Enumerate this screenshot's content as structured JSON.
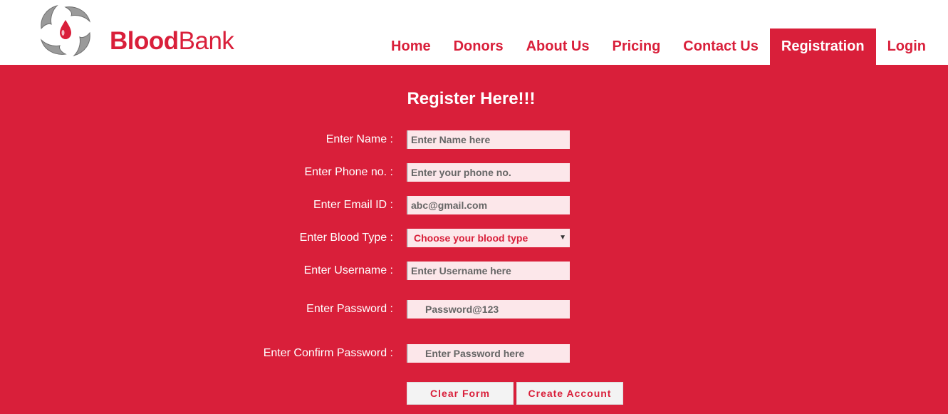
{
  "brand": {
    "bold": "Blood",
    "rest": "Bank"
  },
  "nav": {
    "items": [
      {
        "label": "Home",
        "active": false
      },
      {
        "label": "Donors",
        "active": false
      },
      {
        "label": "About Us",
        "active": false
      },
      {
        "label": "Pricing",
        "active": false
      },
      {
        "label": "Contact Us",
        "active": false
      },
      {
        "label": "Registration",
        "active": true
      },
      {
        "label": "Login",
        "active": false
      }
    ]
  },
  "form": {
    "title": "Register Here!!!",
    "name": {
      "label": "Enter Name :",
      "placeholder": "Enter Name here",
      "value": ""
    },
    "phone": {
      "label": "Enter Phone no. :",
      "placeholder": "Enter your phone no.",
      "value": ""
    },
    "email": {
      "label": "Enter Email ID :",
      "placeholder": "abc@gmail.com",
      "value": ""
    },
    "blood_type": {
      "label": "Enter Blood Type :",
      "selected": "Choose your blood type"
    },
    "username": {
      "label": "Enter Username :",
      "placeholder": "Enter Username here",
      "value": ""
    },
    "password": {
      "label": "Enter Password :",
      "placeholder": "Password@123",
      "value": ""
    },
    "confirm_password": {
      "label": "Enter Confirm Password :",
      "placeholder": "Enter Password here",
      "value": ""
    },
    "clear_label": "Clear Form",
    "create_label": "Create Account"
  },
  "colors": {
    "accent": "#d91f3a",
    "field_bg": "#fce7ea",
    "white": "#ffffff"
  }
}
